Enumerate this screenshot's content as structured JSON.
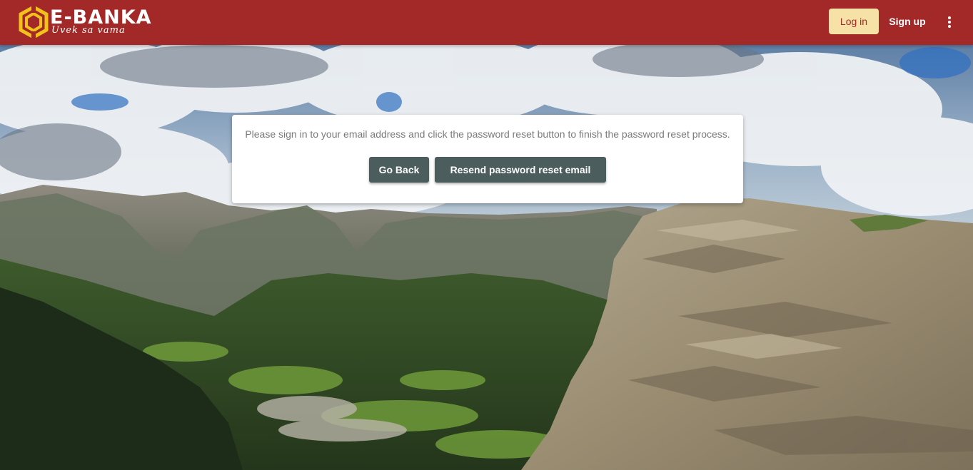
{
  "header": {
    "brand": "E-BANKA",
    "tagline": "Uvek sa vama",
    "login_label": "Log in",
    "signup_label": "Sign up",
    "menu_icon": "more-vert-icon"
  },
  "card": {
    "message": "Please sign in to your email address and click the password reset button to finish the password reset process.",
    "go_back_label": "Go Back",
    "resend_label": "Resend password reset email"
  },
  "colors": {
    "header_bg": "#a32828",
    "login_bg": "#f6e2a6",
    "button_bg": "#4b5e5d",
    "logo_yellow": "#f2c21b"
  }
}
